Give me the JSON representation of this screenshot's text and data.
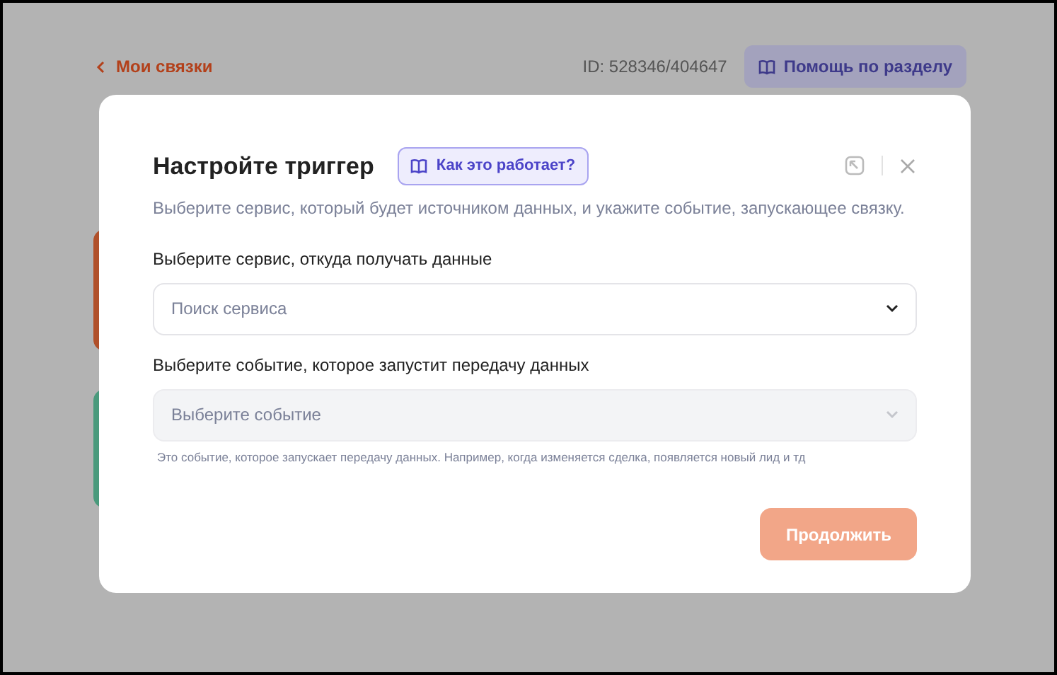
{
  "header": {
    "back_link": "Мои связки",
    "id_text": "ID: 528346/404647",
    "help_button": "Помощь по разделу"
  },
  "modal": {
    "title": "Настройте триггер",
    "help_link": "Как это работает?",
    "description": "Выберите сервис, который будет источником данных, и укажите событие, запускающее связку.",
    "fields": [
      {
        "label": "Выберите сервис, откуда получать данные",
        "placeholder": "Поиск сервиса",
        "disabled": false
      },
      {
        "label": "Выберите событие, которое запустит передачу данных",
        "placeholder": "Выберите событие",
        "disabled": true,
        "hint": "Это событие, которое запускает передачу данных. Например, когда изменяется сделка, появляется новый лид и тд"
      }
    ],
    "continue_button": {
      "label": "Продолжить",
      "disabled": true
    }
  }
}
